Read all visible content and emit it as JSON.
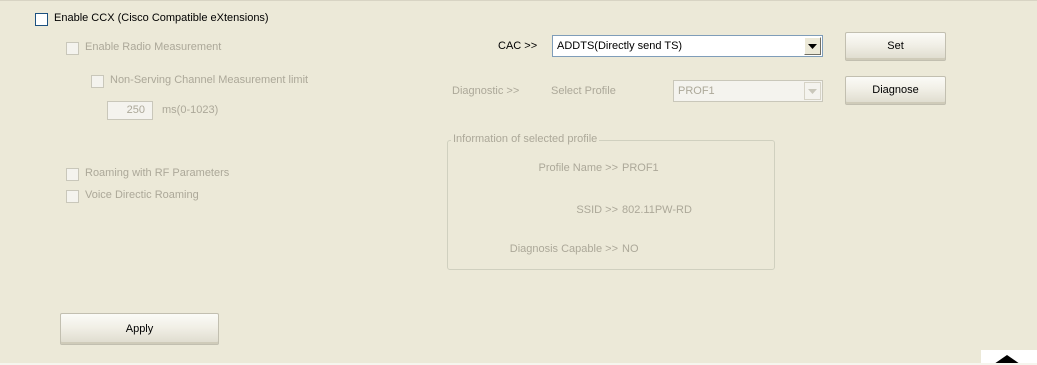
{
  "ccx": {
    "enable_label": "Enable CCX (Cisco Compatible eXtensions)",
    "enable_checked": false,
    "radio_measurement_label": "Enable Radio Measurement",
    "non_serving_label": "Non-Serving Channel Measurement limit",
    "limit_value": "250",
    "limit_unit": "ms(0-1023)",
    "roaming_rf_label": "Roaming with RF Parameters",
    "voice_roaming_label": "Voice Directic Roaming"
  },
  "cac": {
    "label": "CAC >>",
    "selected": "ADDTS(Directly send TS)"
  },
  "diagnostic": {
    "label": "Diagnostic >>",
    "select_profile_label": "Select Profile",
    "selected_profile": "PROF1"
  },
  "buttons": {
    "set": "Set",
    "diagnose": "Diagnose",
    "apply": "Apply"
  },
  "profile_info": {
    "group_title": "Information of selected profile",
    "profile_name_label": "Profile Name >>",
    "profile_name_value": "PROF1",
    "ssid_label": "SSID >>",
    "ssid_value": "802.11PW-RD",
    "diagnosis_capable_label": "Diagnosis Capable >>",
    "diagnosis_capable_value": "NO"
  },
  "icons": {
    "dropdown": "chevron-down-icon",
    "scroll": "triangle-up-icon"
  },
  "colors": {
    "background": "#ece9d8",
    "disabled_text": "#aca899",
    "checkbox_border": "#1c5180"
  }
}
